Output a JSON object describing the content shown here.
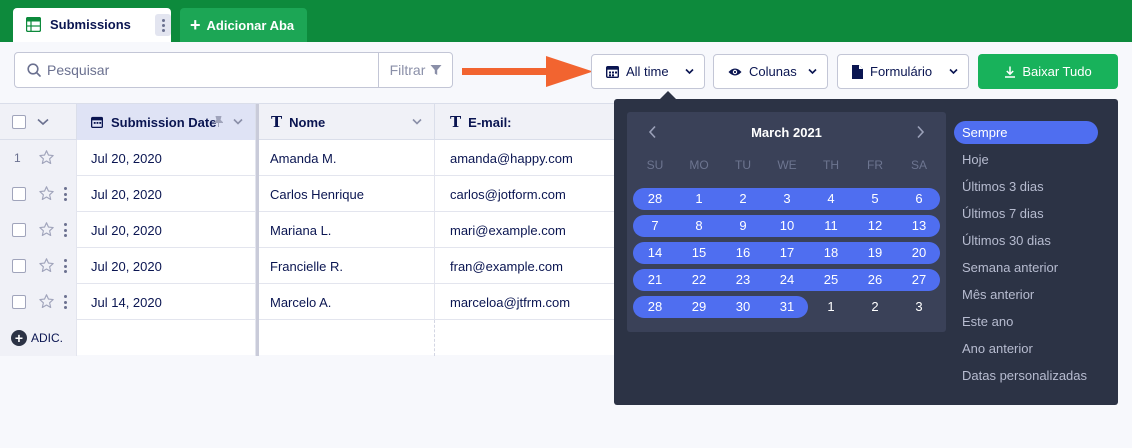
{
  "tabs": {
    "active_label": "Submissions",
    "add_label": "Adicionar Aba"
  },
  "toolbar": {
    "search_placeholder": "Pesquisar",
    "filter_label": "Filtrar",
    "date_label": "All time",
    "columns_label": "Colunas",
    "form_label": "Formulário",
    "download_label": "Baixar Tudo"
  },
  "table": {
    "headers": [
      "Submission Date",
      "Nome",
      "E-mail:"
    ],
    "rows": [
      {
        "num": "1",
        "date": "Jul 20, 2020",
        "name": "Amanda M.",
        "email": "amanda@happy.com"
      },
      {
        "num": "",
        "date": "Jul 20, 2020",
        "name": "Carlos Henrique",
        "email": "carlos@jotform.com"
      },
      {
        "num": "",
        "date": "Jul 20, 2020",
        "name": "Mariana L.",
        "email": "mari@example.com"
      },
      {
        "num": "",
        "date": "Jul 20, 2020",
        "name": "Francielle R.",
        "email": "fran@example.com"
      },
      {
        "num": "",
        "date": "Jul 14, 2020",
        "name": "Marcelo A.",
        "email": "marceloa@jtfrm.com"
      }
    ],
    "add_label": "ADIC."
  },
  "calendar": {
    "month_title": "March 2021",
    "weekdays": [
      "SU",
      "MO",
      "TU",
      "WE",
      "TH",
      "FR",
      "SA"
    ],
    "weeks": [
      [
        "28",
        "1",
        "2",
        "3",
        "4",
        "5",
        "6"
      ],
      [
        "7",
        "8",
        "9",
        "10",
        "11",
        "12",
        "13"
      ],
      [
        "14",
        "15",
        "16",
        "17",
        "18",
        "19",
        "20"
      ],
      [
        "21",
        "22",
        "23",
        "24",
        "25",
        "26",
        "27"
      ],
      [
        "28",
        "29",
        "30",
        "31",
        "1",
        "2",
        "3"
      ]
    ],
    "selected_through_day": "31"
  },
  "presets": [
    {
      "label": "Sempre",
      "active": true
    },
    {
      "label": "Hoje",
      "active": false
    },
    {
      "label": "Últimos 3 dias",
      "active": false
    },
    {
      "label": "Últimos 7 dias",
      "active": false
    },
    {
      "label": "Últimos 30 dias",
      "active": false
    },
    {
      "label": "Semana anterior",
      "active": false
    },
    {
      "label": "Mês anterior",
      "active": false
    },
    {
      "label": "Este ano",
      "active": false
    },
    {
      "label": "Ano anterior",
      "active": false
    },
    {
      "label": "Datas personalizadas",
      "active": false
    }
  ],
  "colors": {
    "brand_green": "#0d8a3c",
    "download_green": "#18b25b",
    "picker_bg": "#2c3345",
    "selection_blue": "#4f6ef0",
    "annotation_arrow": "#f26430"
  },
  "icons": [
    "spreadsheet-icon",
    "plus-icon",
    "search-icon",
    "filter-icon",
    "calendar-icon",
    "eye-icon",
    "document-icon",
    "download-icon",
    "chevron-down-icon",
    "star-icon",
    "text-type-icon",
    "pin-icon",
    "kebab-icon",
    "arrow-annotation"
  ]
}
